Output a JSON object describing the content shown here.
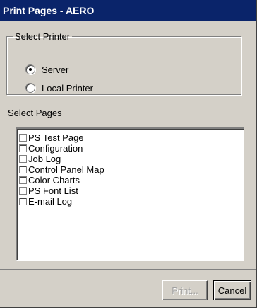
{
  "window": {
    "title": "Print Pages - AERO"
  },
  "printer_group": {
    "legend": "Select Printer",
    "options": [
      {
        "label": "Server",
        "checked": true
      },
      {
        "label": "Local Printer",
        "checked": false
      }
    ]
  },
  "pages": {
    "label": "Select Pages",
    "items": [
      {
        "label": "PS Test Page",
        "checked": false
      },
      {
        "label": "Configuration",
        "checked": false
      },
      {
        "label": "Job Log",
        "checked": false
      },
      {
        "label": "Control Panel Map",
        "checked": false
      },
      {
        "label": "Color Charts",
        "checked": false
      },
      {
        "label": "PS Font List",
        "checked": false
      },
      {
        "label": "E-mail Log",
        "checked": false
      }
    ]
  },
  "buttons": {
    "print": "Print...",
    "cancel": "Cancel"
  }
}
